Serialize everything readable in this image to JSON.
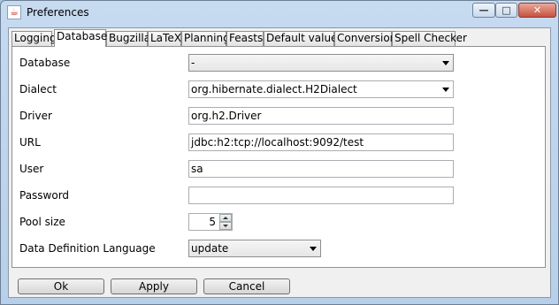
{
  "window": {
    "title": "Preferences",
    "controls": {
      "minimize": "—",
      "maximize": "□",
      "close": "✕"
    }
  },
  "tabs": [
    {
      "label": "Logging"
    },
    {
      "label": "Database",
      "active": true
    },
    {
      "label": "Bugzilla"
    },
    {
      "label": "LaTeX"
    },
    {
      "label": "Planning"
    },
    {
      "label": "Feasts"
    },
    {
      "label": "Default values"
    },
    {
      "label": "Conversion"
    },
    {
      "label": "Spell Checker"
    }
  ],
  "form": {
    "database": {
      "label": "Database",
      "value": "-"
    },
    "dialect": {
      "label": "Dialect",
      "value": "org.hibernate.dialect.H2Dialect"
    },
    "driver": {
      "label": "Driver",
      "value": "org.h2.Driver"
    },
    "url": {
      "label": "URL",
      "value": "jdbc:h2:tcp://localhost:9092/test"
    },
    "user": {
      "label": "User",
      "value": "sa"
    },
    "password": {
      "label": "Password",
      "value": ""
    },
    "pool_size": {
      "label": "Pool size",
      "value": "5"
    },
    "ddl": {
      "label": "Data Definition Language",
      "value": "update"
    }
  },
  "buttons": {
    "ok": "Ok",
    "apply": "Apply",
    "cancel": "Cancel"
  },
  "colors": {
    "title_bar": "#b7cfe9",
    "panel_bg": "#ffffff",
    "close_button": "#c7513e"
  }
}
